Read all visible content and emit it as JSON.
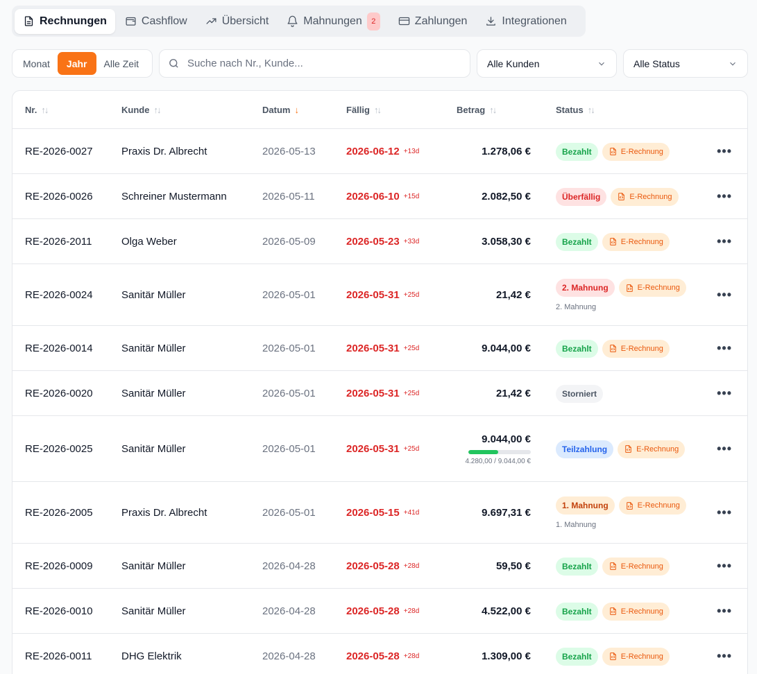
{
  "nav": {
    "tabs": [
      {
        "label": "Rechnungen",
        "icon": "file-text-icon",
        "active": true
      },
      {
        "label": "Cashflow",
        "icon": "wallet-icon",
        "active": false
      },
      {
        "label": "Übersicht",
        "icon": "trending-up-icon",
        "active": false
      },
      {
        "label": "Mahnungen",
        "icon": "bell-icon",
        "active": false,
        "badge": "2"
      },
      {
        "label": "Zahlungen",
        "icon": "credit-card-icon",
        "active": false
      },
      {
        "label": "Integrationen",
        "icon": "download-icon",
        "active": false
      }
    ]
  },
  "filters": {
    "period": [
      "Monat",
      "Jahr",
      "Alle Zeit"
    ],
    "period_active": "Jahr",
    "search_placeholder": "Suche nach Nr., Kunde...",
    "search_value": "",
    "customer_select": "Alle Kunden",
    "status_select": "Alle Status"
  },
  "table": {
    "headers": {
      "nr": "Nr.",
      "kunde": "Kunde",
      "datum": "Datum",
      "faellig": "Fällig",
      "betrag": "Betrag",
      "status": "Status"
    },
    "sort_column": "datum",
    "sort_direction": "desc",
    "e_rechnung_label": "E-Rechnung",
    "rows": [
      {
        "nr": "RE-2026-0027",
        "kunde": "Praxis Dr. Albrecht",
        "datum": "2026-05-13",
        "faellig": "2026-06-12",
        "delta": "+13d",
        "betrag": "1.278,06 €",
        "status": "Bezahlt",
        "status_type": "bezahlt",
        "erechnung": true
      },
      {
        "nr": "RE-2026-0026",
        "kunde": "Schreiner Mustermann",
        "datum": "2026-05-11",
        "faellig": "2026-06-10",
        "delta": "+15d",
        "betrag": "2.082,50 €",
        "status": "Überfällig",
        "status_type": "ueberfaellig",
        "erechnung": true
      },
      {
        "nr": "RE-2026-2011",
        "kunde": "Olga Weber",
        "datum": "2026-05-09",
        "faellig": "2026-05-23",
        "delta": "+33d",
        "betrag": "3.058,30 €",
        "status": "Bezahlt",
        "status_type": "bezahlt",
        "erechnung": true
      },
      {
        "nr": "RE-2026-0024",
        "kunde": "Sanitär Müller",
        "datum": "2026-05-01",
        "faellig": "2026-05-31",
        "delta": "+25d",
        "betrag": "21,42 €",
        "status": "2. Mahnung",
        "status_type": "mahnung2",
        "erechnung": true,
        "sub": "2. Mahnung"
      },
      {
        "nr": "RE-2026-0014",
        "kunde": "Sanitär Müller",
        "datum": "2026-05-01",
        "faellig": "2026-05-31",
        "delta": "+25d",
        "betrag": "9.044,00 €",
        "status": "Bezahlt",
        "status_type": "bezahlt",
        "erechnung": true
      },
      {
        "nr": "RE-2026-0020",
        "kunde": "Sanitär Müller",
        "datum": "2026-05-01",
        "faellig": "2026-05-31",
        "delta": "+25d",
        "betrag": "21,42 €",
        "status": "Storniert",
        "status_type": "storniert",
        "erechnung": false
      },
      {
        "nr": "RE-2026-0025",
        "kunde": "Sanitär Müller",
        "datum": "2026-05-01",
        "faellig": "2026-05-31",
        "delta": "+25d",
        "betrag": "9.044,00 €",
        "status": "Teilzahlung",
        "status_type": "teilzahlung",
        "erechnung": true,
        "paid_text": "4.280,00 / 9.044,00 €",
        "paid_fraction": 0.473
      },
      {
        "nr": "RE-2026-2005",
        "kunde": "Praxis Dr. Albrecht",
        "datum": "2026-05-01",
        "faellig": "2026-05-15",
        "delta": "+41d",
        "betrag": "9.697,31 €",
        "status": "1. Mahnung",
        "status_type": "mahnung1",
        "erechnung": true,
        "sub": "1. Mahnung"
      },
      {
        "nr": "RE-2026-0009",
        "kunde": "Sanitär Müller",
        "datum": "2026-04-28",
        "faellig": "2026-05-28",
        "delta": "+28d",
        "betrag": "59,50 €",
        "status": "Bezahlt",
        "status_type": "bezahlt",
        "erechnung": true
      },
      {
        "nr": "RE-2026-0010",
        "kunde": "Sanitär Müller",
        "datum": "2026-04-28",
        "faellig": "2026-05-28",
        "delta": "+28d",
        "betrag": "4.522,00 €",
        "status": "Bezahlt",
        "status_type": "bezahlt",
        "erechnung": true
      },
      {
        "nr": "RE-2026-0011",
        "kunde": "DHG Elektrik",
        "datum": "2026-04-28",
        "faellig": "2026-05-28",
        "delta": "+28d",
        "betrag": "1.309,00 €",
        "status": "Bezahlt",
        "status_type": "bezahlt",
        "erechnung": true
      }
    ]
  },
  "colors": {
    "accent": "#f97316",
    "overdue": "#dc2626",
    "paid": "#16a34a"
  }
}
